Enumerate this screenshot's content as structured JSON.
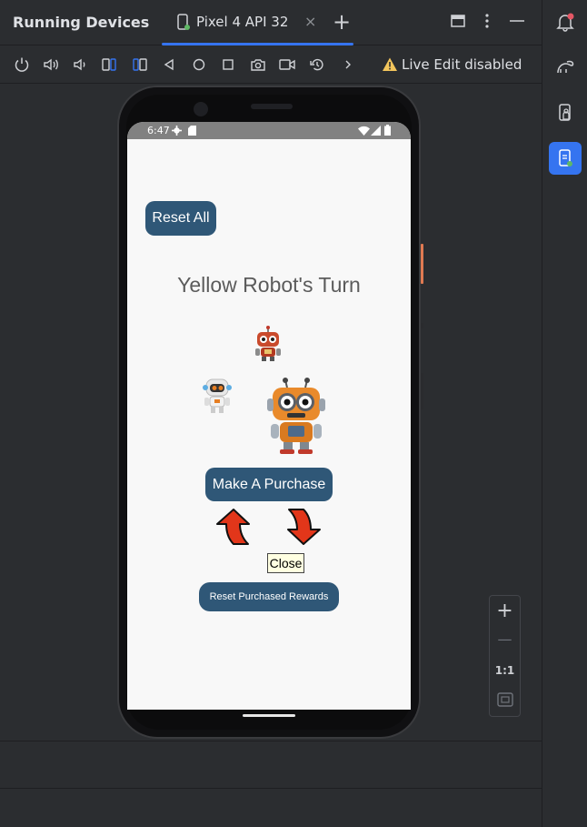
{
  "header": {
    "title": "Running Devices",
    "tab_label": "Pixel 4 API 32",
    "tab_close": "×",
    "add_tab": "+"
  },
  "toolbar": {
    "live_edit_label": "Live Edit disabled"
  },
  "device": {
    "status_time": "6:47",
    "reset_all_label": "Reset All",
    "turn_text": "Yellow Robot's Turn",
    "purchase_label": "Make A Purchase",
    "close_label": "Close",
    "reset_rewards_label": "Reset Purchased Rewards"
  },
  "zoom": {
    "zoom_in": "+",
    "zoom_out": "—",
    "actual_size": "1:1"
  },
  "colors": {
    "accent": "#3574f0",
    "app_button": "#2f5777",
    "arrow_red": "#e2361a"
  }
}
